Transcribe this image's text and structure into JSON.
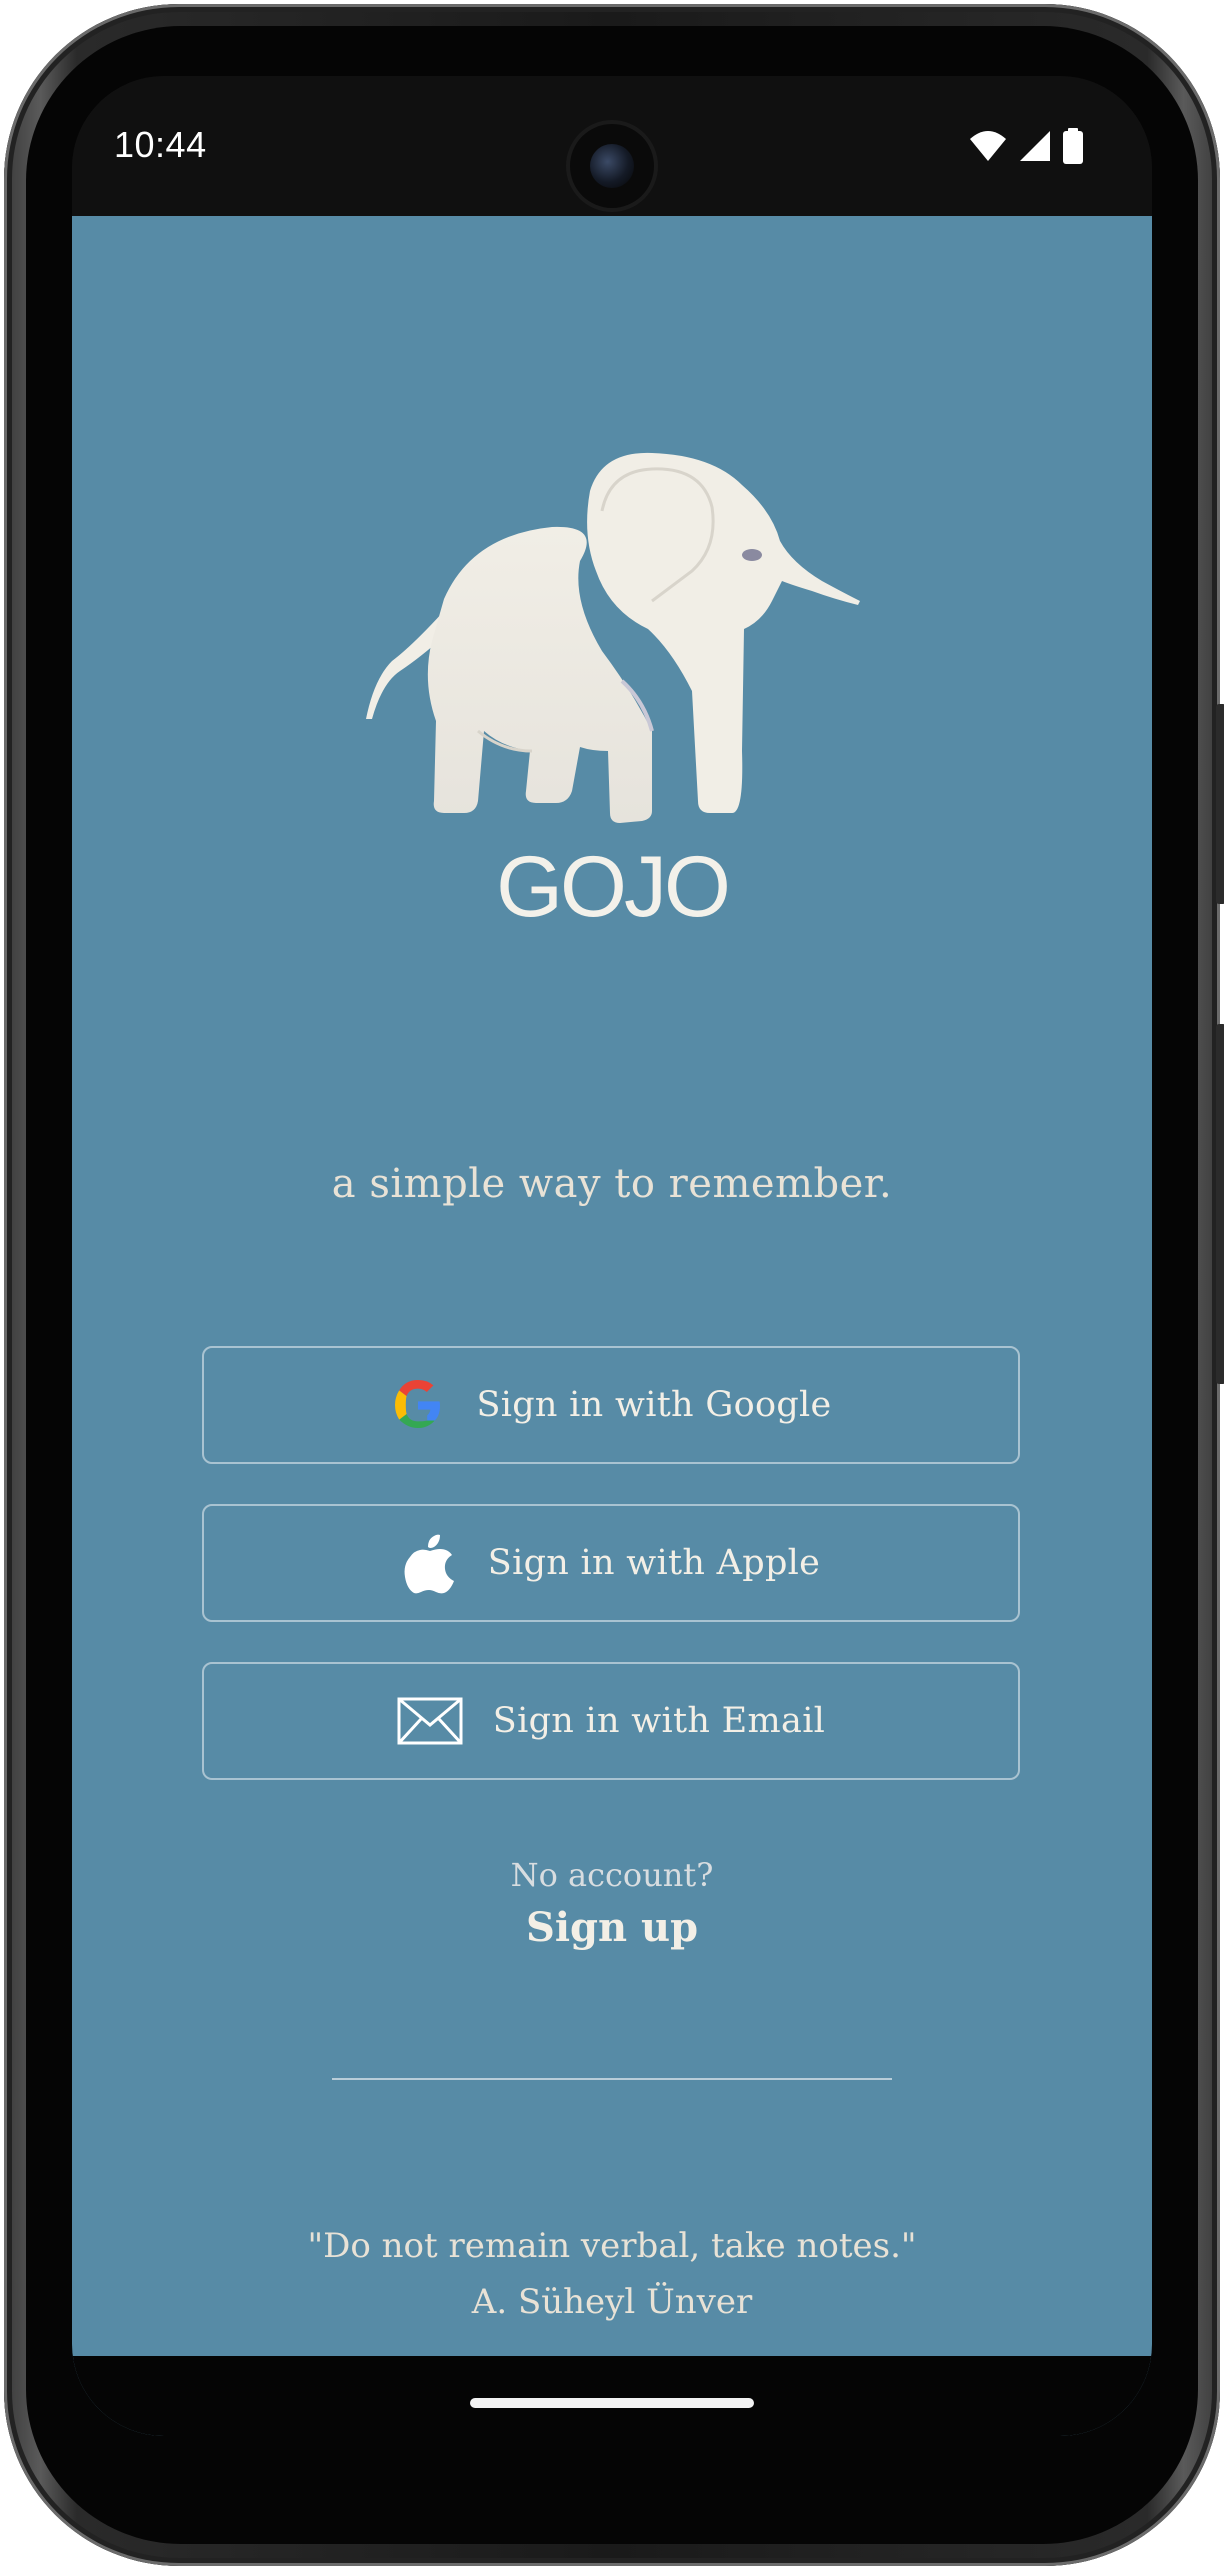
{
  "status_bar": {
    "time": "10:44",
    "icons": [
      "wifi-icon",
      "signal-icon",
      "battery-icon"
    ]
  },
  "app": {
    "brand_name": "GOJO",
    "tagline": "a simple way to remember.",
    "background_color": "#578ba6",
    "buttons": {
      "google": {
        "label": "Sign in with Google",
        "icon": "google-icon"
      },
      "apple": {
        "label": "Sign in with Apple",
        "icon": "apple-icon"
      },
      "email": {
        "label": "Sign in with Email",
        "icon": "envelope-icon"
      }
    },
    "no_account_text": "No account?",
    "signup_label": "Sign up",
    "quote": {
      "text": "\"Do not remain verbal, take notes.\"",
      "author": "A. Süheyl Ünver"
    }
  }
}
